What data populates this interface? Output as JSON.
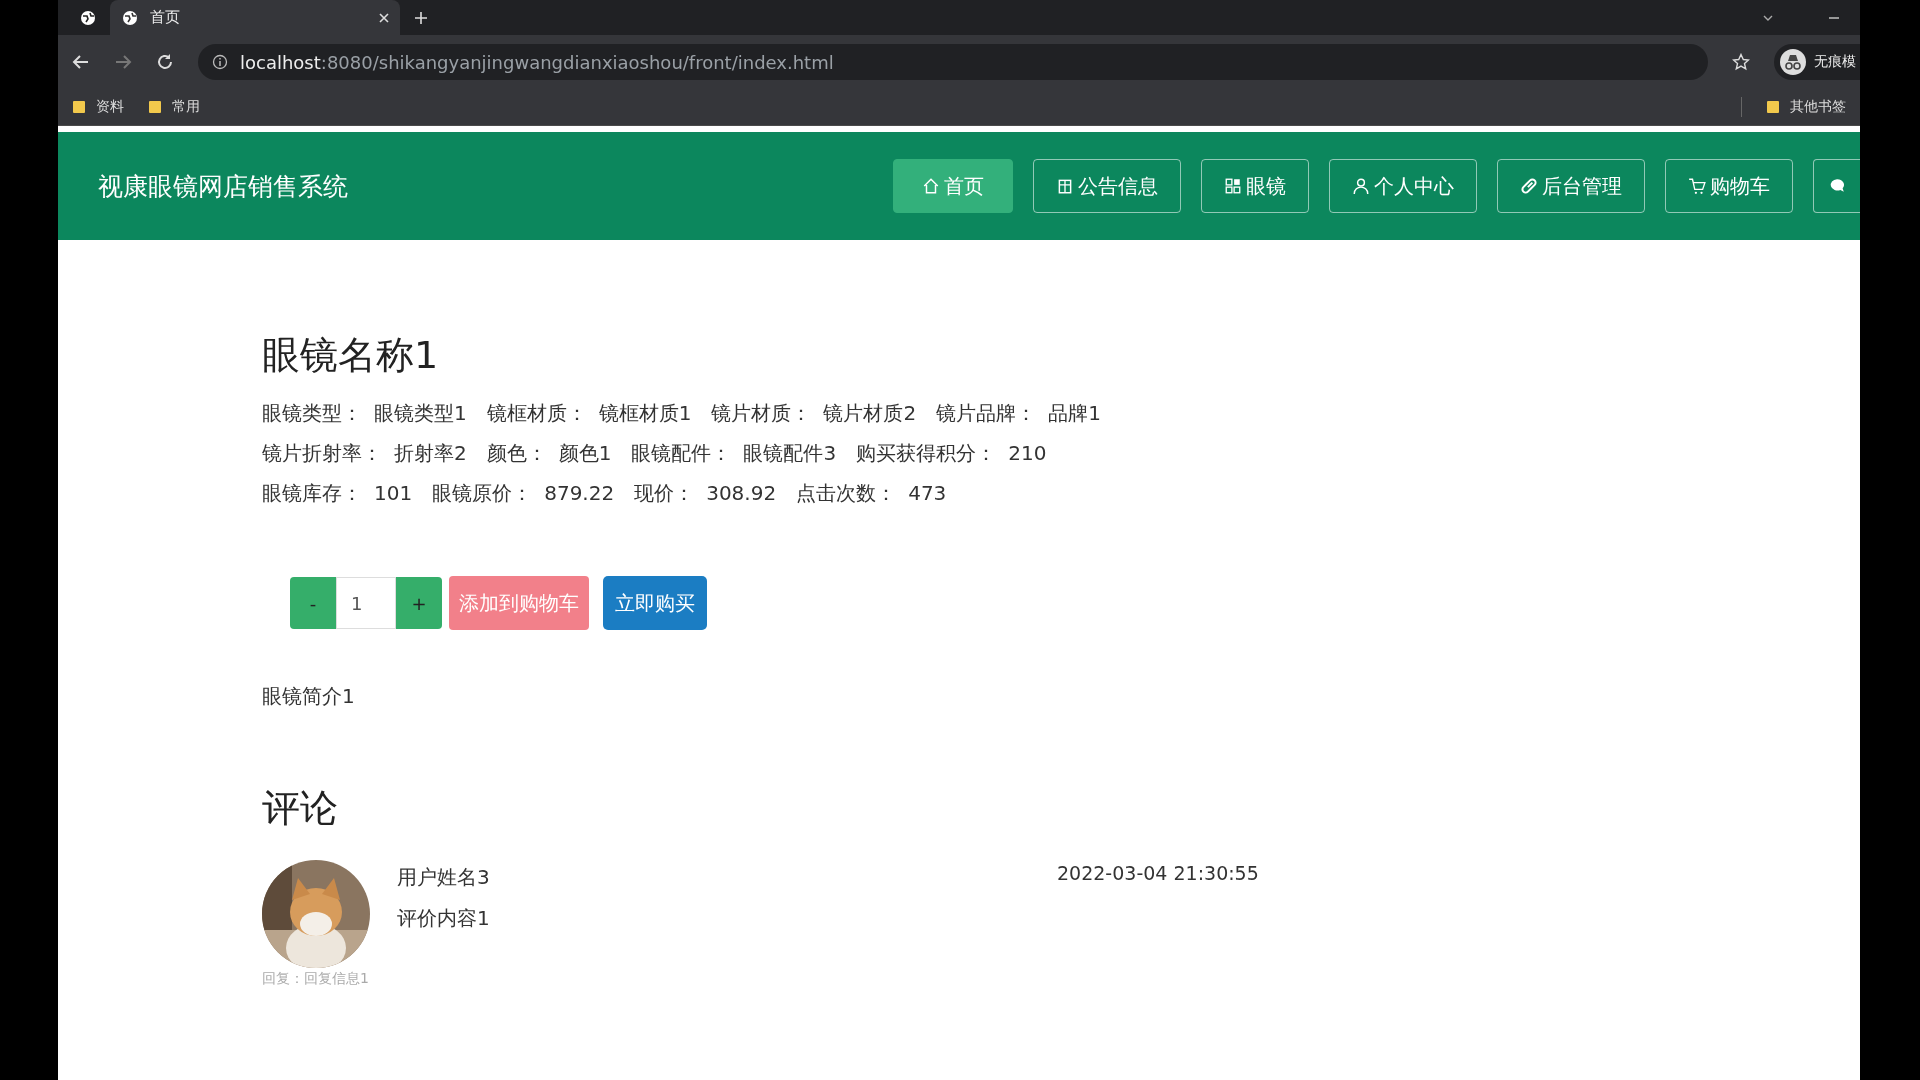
{
  "browser": {
    "tab_title": "首页",
    "url_host": "localhost",
    "url_path": ":8080/shikangyanjingwangdianxiaoshou/front/index.html",
    "profile_label": "无痕模",
    "bookmarks": [
      "资料",
      "常用"
    ],
    "other_bookmarks": "其他书签"
  },
  "nav": {
    "site_title": "视康眼镜网店销售系统",
    "items": [
      {
        "kind": "home",
        "label": "首页",
        "selected": true
      },
      {
        "kind": "notice",
        "label": "公告信息",
        "selected": false
      },
      {
        "kind": "grid",
        "label": "眼镜",
        "selected": false
      },
      {
        "kind": "user",
        "label": "个人中心",
        "selected": false
      },
      {
        "kind": "link",
        "label": "后台管理",
        "selected": false
      },
      {
        "kind": "cart",
        "label": "购物车",
        "selected": false
      },
      {
        "kind": "chat",
        "selected": false
      }
    ]
  },
  "product": {
    "name": "眼镜名称1",
    "attribute_lines": [
      [
        {
          "label": "眼镜类型：",
          "value": "眼镜类型1"
        },
        {
          "label": "镜框材质：",
          "value": "镜框材质1"
        },
        {
          "label": "镜片材质：",
          "value": "镜片材质2"
        },
        {
          "label": "镜片品牌：",
          "value": "品牌1"
        }
      ],
      [
        {
          "label": "镜片折射率：",
          "value": "折射率2"
        },
        {
          "label": "颜色：",
          "value": "颜色1"
        },
        {
          "label": "眼镜配件：",
          "value": "眼镜配件3"
        },
        {
          "label": "购买获得积分：",
          "value": "210"
        }
      ],
      [
        {
          "label": "眼镜库存：",
          "value": "101"
        },
        {
          "label": "眼镜原价：",
          "value": "879.22"
        },
        {
          "label": "现价：",
          "value": "308.92"
        },
        {
          "label": "点击次数：",
          "value": "473"
        }
      ]
    ],
    "minus": "-",
    "quantity": "1",
    "plus": "+",
    "add_to_cart": "添加到购物车",
    "buy_now": "立即购买",
    "intro": "眼镜简介1"
  },
  "comments": {
    "heading": "评论",
    "items": [
      {
        "user": "用户姓名3",
        "content": "评价内容1",
        "time": "2022-03-04 21:30:55",
        "reply": "回复：回复信息1"
      }
    ]
  }
}
